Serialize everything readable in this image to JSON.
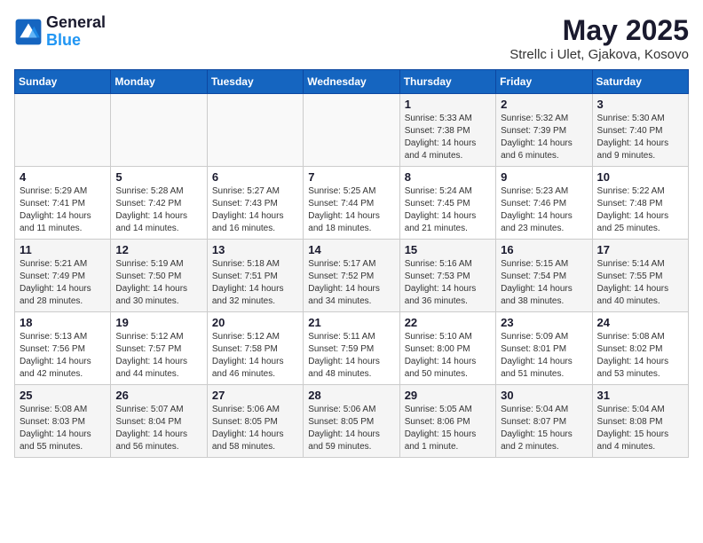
{
  "logo": {
    "line1": "General",
    "line2": "Blue"
  },
  "title": "May 2025",
  "subtitle": "Strellc i Ulet, Gjakova, Kosovo",
  "days_of_week": [
    "Sunday",
    "Monday",
    "Tuesday",
    "Wednesday",
    "Thursday",
    "Friday",
    "Saturday"
  ],
  "weeks": [
    [
      {
        "day": "",
        "info": ""
      },
      {
        "day": "",
        "info": ""
      },
      {
        "day": "",
        "info": ""
      },
      {
        "day": "",
        "info": ""
      },
      {
        "day": "1",
        "info": "Sunrise: 5:33 AM\nSunset: 7:38 PM\nDaylight: 14 hours\nand 4 minutes."
      },
      {
        "day": "2",
        "info": "Sunrise: 5:32 AM\nSunset: 7:39 PM\nDaylight: 14 hours\nand 6 minutes."
      },
      {
        "day": "3",
        "info": "Sunrise: 5:30 AM\nSunset: 7:40 PM\nDaylight: 14 hours\nand 9 minutes."
      }
    ],
    [
      {
        "day": "4",
        "info": "Sunrise: 5:29 AM\nSunset: 7:41 PM\nDaylight: 14 hours\nand 11 minutes."
      },
      {
        "day": "5",
        "info": "Sunrise: 5:28 AM\nSunset: 7:42 PM\nDaylight: 14 hours\nand 14 minutes."
      },
      {
        "day": "6",
        "info": "Sunrise: 5:27 AM\nSunset: 7:43 PM\nDaylight: 14 hours\nand 16 minutes."
      },
      {
        "day": "7",
        "info": "Sunrise: 5:25 AM\nSunset: 7:44 PM\nDaylight: 14 hours\nand 18 minutes."
      },
      {
        "day": "8",
        "info": "Sunrise: 5:24 AM\nSunset: 7:45 PM\nDaylight: 14 hours\nand 21 minutes."
      },
      {
        "day": "9",
        "info": "Sunrise: 5:23 AM\nSunset: 7:46 PM\nDaylight: 14 hours\nand 23 minutes."
      },
      {
        "day": "10",
        "info": "Sunrise: 5:22 AM\nSunset: 7:48 PM\nDaylight: 14 hours\nand 25 minutes."
      }
    ],
    [
      {
        "day": "11",
        "info": "Sunrise: 5:21 AM\nSunset: 7:49 PM\nDaylight: 14 hours\nand 28 minutes."
      },
      {
        "day": "12",
        "info": "Sunrise: 5:19 AM\nSunset: 7:50 PM\nDaylight: 14 hours\nand 30 minutes."
      },
      {
        "day": "13",
        "info": "Sunrise: 5:18 AM\nSunset: 7:51 PM\nDaylight: 14 hours\nand 32 minutes."
      },
      {
        "day": "14",
        "info": "Sunrise: 5:17 AM\nSunset: 7:52 PM\nDaylight: 14 hours\nand 34 minutes."
      },
      {
        "day": "15",
        "info": "Sunrise: 5:16 AM\nSunset: 7:53 PM\nDaylight: 14 hours\nand 36 minutes."
      },
      {
        "day": "16",
        "info": "Sunrise: 5:15 AM\nSunset: 7:54 PM\nDaylight: 14 hours\nand 38 minutes."
      },
      {
        "day": "17",
        "info": "Sunrise: 5:14 AM\nSunset: 7:55 PM\nDaylight: 14 hours\nand 40 minutes."
      }
    ],
    [
      {
        "day": "18",
        "info": "Sunrise: 5:13 AM\nSunset: 7:56 PM\nDaylight: 14 hours\nand 42 minutes."
      },
      {
        "day": "19",
        "info": "Sunrise: 5:12 AM\nSunset: 7:57 PM\nDaylight: 14 hours\nand 44 minutes."
      },
      {
        "day": "20",
        "info": "Sunrise: 5:12 AM\nSunset: 7:58 PM\nDaylight: 14 hours\nand 46 minutes."
      },
      {
        "day": "21",
        "info": "Sunrise: 5:11 AM\nSunset: 7:59 PM\nDaylight: 14 hours\nand 48 minutes."
      },
      {
        "day": "22",
        "info": "Sunrise: 5:10 AM\nSunset: 8:00 PM\nDaylight: 14 hours\nand 50 minutes."
      },
      {
        "day": "23",
        "info": "Sunrise: 5:09 AM\nSunset: 8:01 PM\nDaylight: 14 hours\nand 51 minutes."
      },
      {
        "day": "24",
        "info": "Sunrise: 5:08 AM\nSunset: 8:02 PM\nDaylight: 14 hours\nand 53 minutes."
      }
    ],
    [
      {
        "day": "25",
        "info": "Sunrise: 5:08 AM\nSunset: 8:03 PM\nDaylight: 14 hours\nand 55 minutes."
      },
      {
        "day": "26",
        "info": "Sunrise: 5:07 AM\nSunset: 8:04 PM\nDaylight: 14 hours\nand 56 minutes."
      },
      {
        "day": "27",
        "info": "Sunrise: 5:06 AM\nSunset: 8:05 PM\nDaylight: 14 hours\nand 58 minutes."
      },
      {
        "day": "28",
        "info": "Sunrise: 5:06 AM\nSunset: 8:05 PM\nDaylight: 14 hours\nand 59 minutes."
      },
      {
        "day": "29",
        "info": "Sunrise: 5:05 AM\nSunset: 8:06 PM\nDaylight: 15 hours\nand 1 minute."
      },
      {
        "day": "30",
        "info": "Sunrise: 5:04 AM\nSunset: 8:07 PM\nDaylight: 15 hours\nand 2 minutes."
      },
      {
        "day": "31",
        "info": "Sunrise: 5:04 AM\nSunset: 8:08 PM\nDaylight: 15 hours\nand 4 minutes."
      }
    ]
  ]
}
